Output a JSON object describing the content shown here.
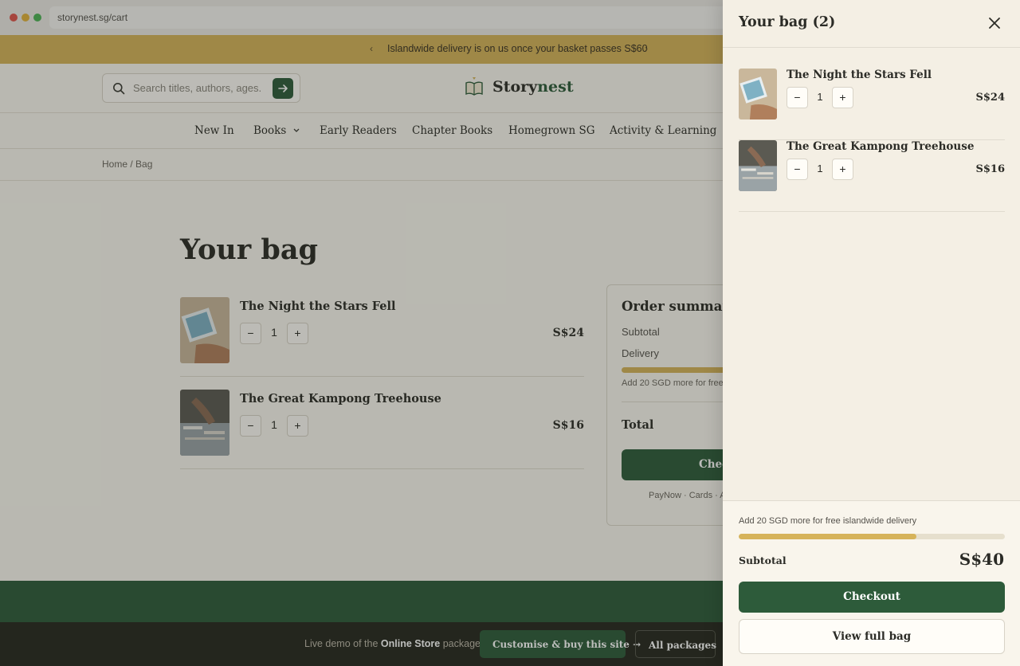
{
  "browser": {
    "url": "storynest.sg/cart",
    "dot_colors": [
      "#e0534b",
      "#e2b23c",
      "#4cb455"
    ]
  },
  "announcement": {
    "text": "Islandwide delivery is on us once your basket passes S$60",
    "prev_icon": "chevron-left-icon",
    "next_icon": "chevron-right-icon"
  },
  "header": {
    "search_placeholder": "Search titles, authors, ages.",
    "brand_part1": "Story",
    "brand_part2": "nest",
    "brand_color": "#2d5b3a"
  },
  "nav": {
    "items": [
      "New In",
      "Books",
      "Early Readers",
      "Chapter Books",
      "Homegrown SG",
      "Activity & Learning"
    ]
  },
  "breadcrumb": "Home / Bag",
  "cart": {
    "title": "Your bag",
    "items": [
      {
        "title": "The Night the Stars Fell",
        "qty": "1",
        "price": "S$24",
        "minus": "−",
        "plus": "+"
      },
      {
        "title": "The Great Kampong Treehouse",
        "qty": "1",
        "price": "S$16",
        "minus": "−",
        "plus": "+"
      }
    ]
  },
  "summary": {
    "title": "Order summary",
    "subtotal_label": "Subtotal",
    "delivery_label": "Delivery",
    "note": "Add 20 SGD more for free",
    "total_label": "Total",
    "checkout_label": "Chec",
    "payments": "PayNow · Cards · At"
  },
  "demo_bar": {
    "pre": "Live demo of the ",
    "product": "Online Store",
    "post": " package.",
    "cta": "Customise & buy this site →",
    "alt": "All packages"
  },
  "drawer": {
    "title": "Your bag (2)",
    "items": [
      {
        "title": "The Night the Stars Fell",
        "qty": "1",
        "price": "S$24",
        "minus": "−",
        "plus": "+"
      },
      {
        "title": "The Great Kampong Treehouse",
        "qty": "1",
        "price": "S$16",
        "minus": "−",
        "plus": "+"
      }
    ],
    "free_delivery_note": "Add 20 SGD more for free islandwide delivery",
    "progress_fraction": 0.667,
    "subtotal_label": "Subtotal",
    "subtotal_value": "S$40",
    "checkout_label": "Checkout",
    "view_full_label": "View full bag"
  }
}
